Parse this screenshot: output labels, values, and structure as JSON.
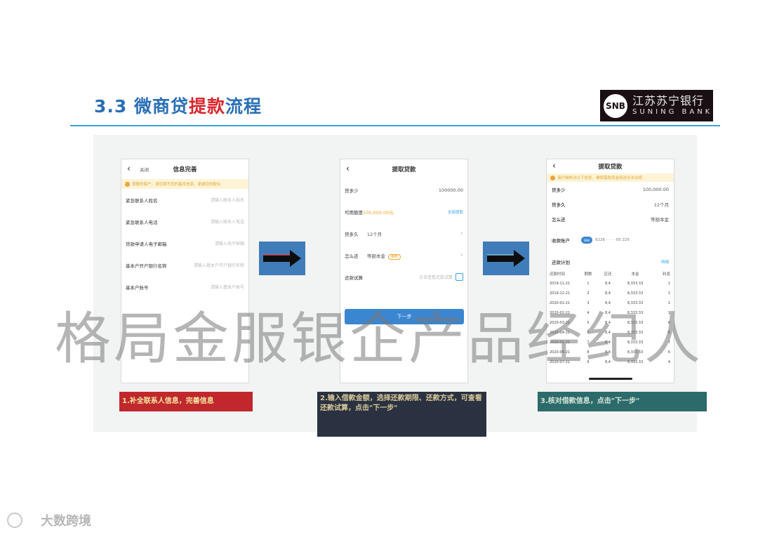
{
  "slide": {
    "title_num": "3.3",
    "title_a": "微商贷",
    "title_b": "提款",
    "title_c": "流程",
    "logo_mark": "SNB",
    "logo_cn": "江苏苏宁银行",
    "logo_en": "SUNING BANK"
  },
  "phone1": {
    "back_icon": "‹",
    "close": "关闭",
    "title": "信息完善",
    "notice": "尊敬的客户，请您填写您的基本信息，谢谢您的配合",
    "rows": [
      {
        "label": "紧急联系人姓名",
        "placeholder": "请输入联系人姓名"
      },
      {
        "label": "紧急联系人电话",
        "placeholder": "请输入联系人电话"
      },
      {
        "label": "贷款申请人电子邮箱",
        "placeholder": "请输入电子邮箱"
      },
      {
        "label": "基本户开户银行名称",
        "placeholder": "请输入基本户开户银行名称"
      },
      {
        "label": "基本户账号",
        "placeholder": "请输入基本户账号"
      }
    ]
  },
  "phone2": {
    "back_icon": "‹",
    "title": "提取贷款",
    "rows": [
      {
        "label": "贷多少",
        "value": "100000.00"
      },
      {
        "label": "可用额度",
        "value": "100,000.00元",
        "link": "全部提取"
      },
      {
        "label": "贷多久",
        "value": "12个月"
      },
      {
        "label": "怎么还",
        "value": "等额本金",
        "tag": "推荐"
      },
      {
        "label": "还款试算",
        "value": "点击查看还款试算"
      }
    ],
    "next_button": "下一步"
  },
  "phone3": {
    "back_icon": "‹",
    "title": "提取贷款",
    "notice": "请仔细核对以下信息，确保借款资金用途合法合规",
    "rows": [
      {
        "label": "贷多少",
        "value": "100,000.00"
      },
      {
        "label": "贷多久",
        "value": "12个月"
      },
      {
        "label": "怎么还",
        "value": "等额本金"
      }
    ],
    "account_label": "收款账户",
    "account_badge": "SNB",
    "account_num": "6226 · · · · 05 225",
    "plan_label": "还款计划",
    "plan_link": "明细",
    "schedule_headers": [
      "还款时间",
      "期数",
      "应还",
      "本金",
      "利息"
    ],
    "schedule": [
      [
        "2019-11-21",
        "1",
        "8,4",
        "8,333.33",
        "1"
      ],
      [
        "2019-12-21",
        "2",
        "8,4",
        "8,333.33",
        "1"
      ],
      [
        "2020-01-21",
        "3",
        "8,4",
        "8,333.33",
        "1"
      ],
      [
        "2020-02-21",
        "4",
        "8,4",
        "8,333.33",
        "1"
      ],
      [
        "2020-03-21",
        "5",
        "8,4",
        "8,333.33",
        "8"
      ],
      [
        "2020-04-21",
        "6",
        "8,4",
        "8,333.33",
        "8"
      ],
      [
        "2020-05-21",
        "7",
        "8,4",
        "8,333.33",
        "7"
      ],
      [
        "2020-06-21",
        "8",
        "8,4",
        "8,333.33",
        "6"
      ],
      [
        "2020-07-21",
        "9",
        "8,4",
        "8,333.33",
        "4"
      ]
    ]
  },
  "captions": {
    "c1": "1.补全联系人信息，完善信息",
    "c2": "2.输入借款金额，选择还款期限、还款方式，可查看还款试算，点击\"下一步\"",
    "c3": "3.核对借款信息，点击\"下一步\""
  },
  "watermark": "格局金服银企产品经纪人",
  "footer": {
    "brand": "大数跨境"
  }
}
